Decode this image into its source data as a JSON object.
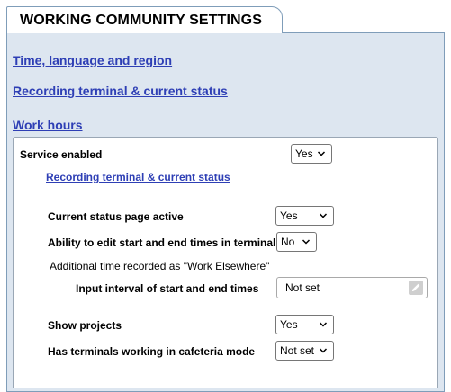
{
  "tab": {
    "title": "WORKING COMMUNITY SETTINGS"
  },
  "sections": {
    "time_language": "Time, language and region",
    "recording_terminal": "Recording terminal & current status",
    "work_hours": "Work hours"
  },
  "work_hours": {
    "service_enabled": {
      "label": "Service enabled",
      "value": "Yes"
    },
    "sublink": "Recording terminal & current status",
    "current_status_page": {
      "label": "Current status page active",
      "value": "Yes"
    },
    "edit_times": {
      "label": "Ability to edit start and end times in terminal",
      "value": "No"
    },
    "additional_time_note": "Additional time recorded as \"Work Elsewhere\"",
    "input_interval": {
      "label": "Input interval of start and end times",
      "value": "Not set"
    },
    "show_projects": {
      "label": "Show projects",
      "value": "Yes"
    },
    "cafeteria_mode": {
      "label": "Has terminals working in cafeteria mode",
      "value": "Not set"
    }
  }
}
